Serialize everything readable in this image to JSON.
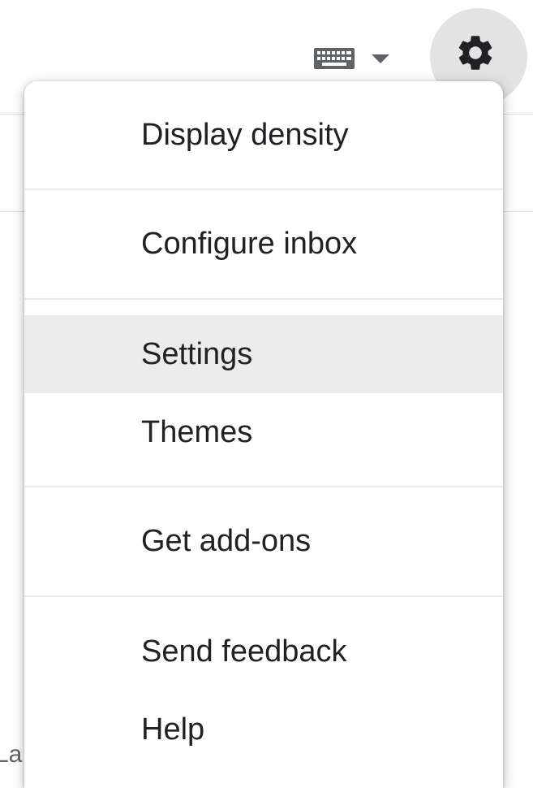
{
  "background": {
    "partial_text": "La"
  },
  "toolbar": {
    "input_tools_icon": "keyboard-icon",
    "input_tools_dropdown_icon": "chevron-down-icon",
    "settings_icon": "gear-icon"
  },
  "menu": {
    "items": [
      {
        "label": "Display density"
      },
      {
        "label": "Configure inbox"
      },
      {
        "label": "Settings"
      },
      {
        "label": "Themes"
      },
      {
        "label": "Get add-ons"
      },
      {
        "label": "Send feedback"
      },
      {
        "label": "Help"
      }
    ],
    "highlighted_item": "Settings"
  },
  "colors": {
    "text": "#202124",
    "icon": "#5f6368",
    "settings_button_bg": "#e3e3e3",
    "highlight_bg": "#ececec",
    "separator": "#e8e8e8"
  }
}
